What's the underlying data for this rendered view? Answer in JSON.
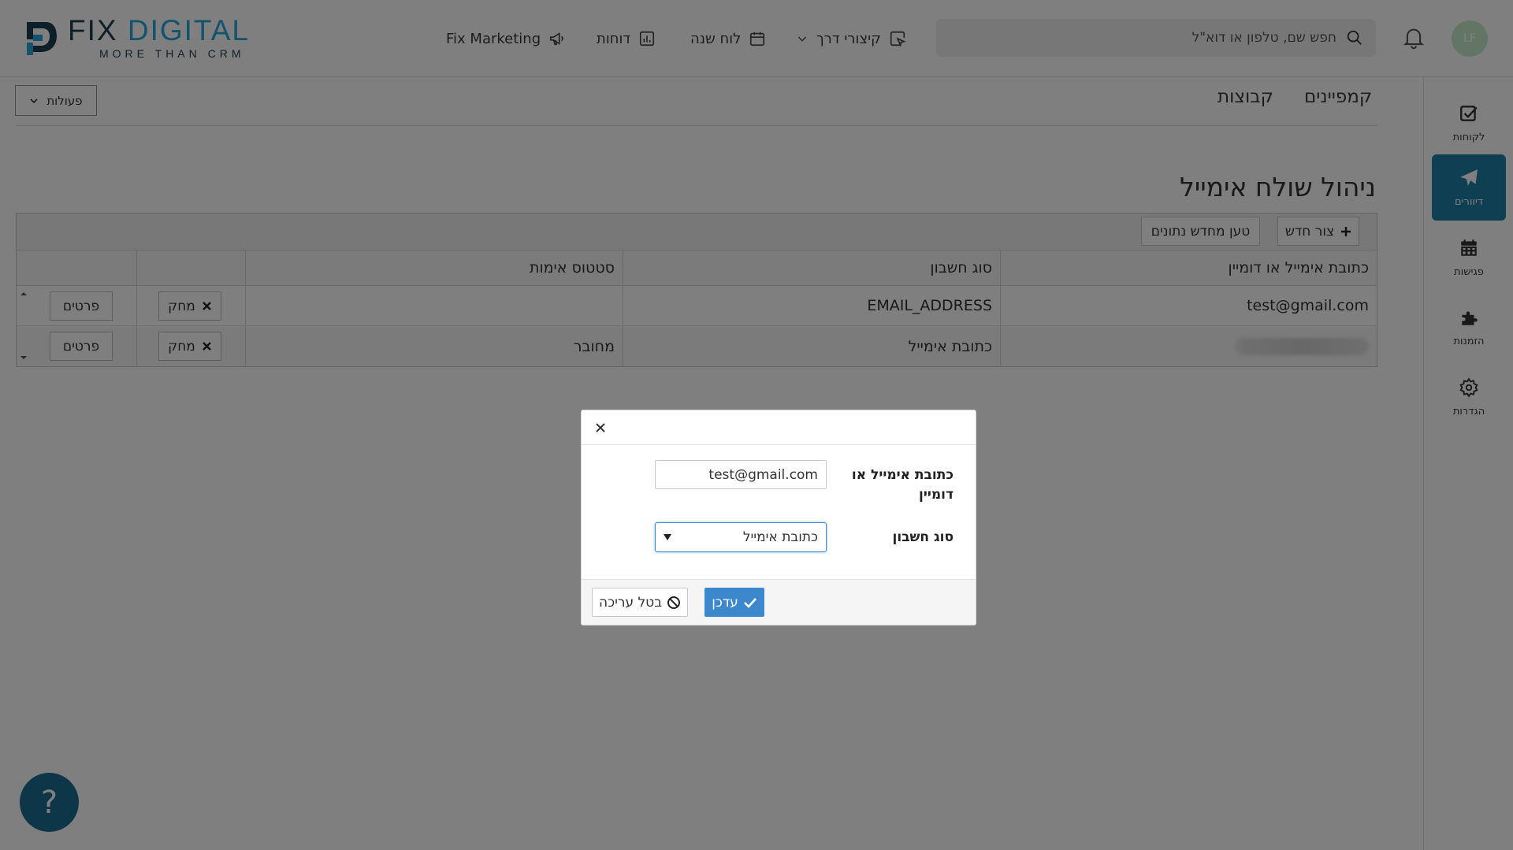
{
  "brand": {
    "name_dark": "FIX",
    "name_accent": "DIGITAL",
    "tagline": "MORE THAN CRM"
  },
  "header": {
    "nav": [
      {
        "label": "Fix Marketing",
        "icon": "megaphone-icon"
      },
      {
        "label": "דוחות",
        "icon": "bar-chart-icon"
      },
      {
        "label": "לוח שנה",
        "icon": "calendar-icon"
      },
      {
        "label": "קיצורי דרך",
        "icon": "cursor-click-icon"
      }
    ],
    "search_placeholder": "חפש שם, טלפון או דוא\"ל",
    "avatar_initials": "LF"
  },
  "sidebar": {
    "items": [
      {
        "label": "לקוחות",
        "icon": "check-square-icon",
        "active": false
      },
      {
        "label": "דיוורים",
        "icon": "paper-plane-icon",
        "active": true
      },
      {
        "label": "פגישות",
        "icon": "calendar-grid-icon",
        "active": false
      },
      {
        "label": "הזמנות",
        "icon": "puzzle-icon",
        "active": false
      },
      {
        "label": "הגדרות",
        "icon": "gear-icon",
        "active": false
      }
    ]
  },
  "main": {
    "tabs": [
      {
        "label": "קמפיינים"
      },
      {
        "label": "קבוצות"
      }
    ],
    "actions_label": "פעולות",
    "title": "ניהול שולח אימייל",
    "toolbar": {
      "new_label": "צור חדש",
      "reload_label": "טען מחדש נתונים"
    },
    "table": {
      "columns": [
        "כתובת אימייל או דומיין",
        "סוג חשבון",
        "סטטוס אימות"
      ],
      "rows": [
        {
          "email": "test@gmail.com",
          "type": "EMAIL_ADDRESS",
          "status": ""
        },
        {
          "email": "",
          "type": "כתובת אימייל",
          "status": "מחובר"
        }
      ],
      "delete_label": "מחק",
      "details_label": "פרטים"
    }
  },
  "modal": {
    "email_label": "כתובת אימייל או דומיין",
    "email_value": "test@gmail.com",
    "type_label": "סוג חשבון",
    "type_value": "כתובת אימייל",
    "cancel_label": "בטל עריכה",
    "update_label": "עדכן"
  },
  "help": {
    "label": "?"
  },
  "colors": {
    "accent": "#1f7fa6",
    "brand_dark": "#1d3e4f",
    "brand_light": "#2aa7d8",
    "primary_button": "#3d87cc",
    "help_button": "#1b6f93"
  }
}
